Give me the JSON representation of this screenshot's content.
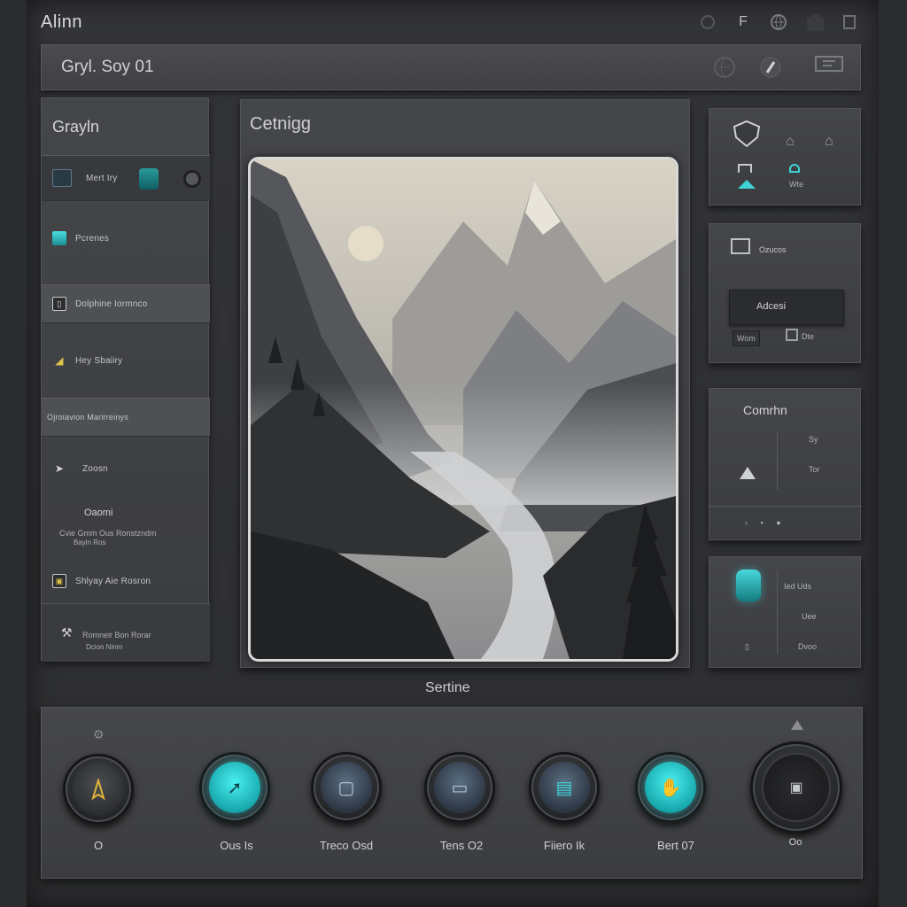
{
  "app": {
    "title": "Alinn"
  },
  "topbar": {
    "icons": [
      "circle-icon",
      "f-icon",
      "globe-icon",
      "camera-icon",
      "window-icon"
    ],
    "f_label": "F"
  },
  "header": {
    "title": "Gryl. Soy 01"
  },
  "sidebar": {
    "title": "Grayln",
    "items": [
      {
        "label": "Mert Iry",
        "icon": "tablet-icon"
      },
      {
        "label": "Pcrenes",
        "icon": "teal-square-icon"
      },
      {
        "label": "Dolphine Iormnco",
        "icon": "doc-icon"
      },
      {
        "label": "Hey Sbaiiry",
        "icon": "pencil-icon"
      },
      {
        "label": "Ojroiavion Marirreinys",
        "icon": ""
      },
      {
        "label": "Zoosn",
        "icon": "send-icon"
      },
      {
        "label": "Oaomi",
        "icon": ""
      },
      {
        "label": "Cvie Gmm Ous Ronstzndm",
        "icon": ""
      },
      {
        "label": "Bayin Ros",
        "icon": ""
      },
      {
        "label": "Shlyay Aie Rosron",
        "icon": "box-icon"
      },
      {
        "label": "Romneir Bon Rorar",
        "icon": "tool-icon"
      },
      {
        "label": "Dcion Ninm",
        "icon": ""
      }
    ]
  },
  "main": {
    "title": "Cetnigg",
    "image_alt": "Misty mountain valley landscape"
  },
  "right": {
    "panel1": {
      "label": "Wte"
    },
    "panel2": {
      "label": "Ozucos",
      "field": "Adcesi",
      "btn1": "Wom",
      "btn2": "Dte"
    },
    "panel3": {
      "title": "Comrhn",
      "r1": "Sy",
      "r2": "Tor"
    },
    "panel4": {
      "r1": "Ied Uds",
      "r2": "Uee",
      "r3": "Dvoo"
    }
  },
  "caption": "Sertine",
  "dock": {
    "knobs": [
      {
        "label": "O",
        "top_icon": "gear-icon"
      },
      {
        "label": "Ous Is"
      },
      {
        "label": "Treco Osd"
      },
      {
        "label": "Tens O2"
      },
      {
        "label": "Fiiero Ik"
      },
      {
        "label": "Bert 07"
      },
      {
        "label": "Oo",
        "top_icon": "triangle-icon"
      }
    ]
  },
  "colors": {
    "accent": "#3fd3d6",
    "bg": "#2b2c2e",
    "panel": "#414245"
  }
}
